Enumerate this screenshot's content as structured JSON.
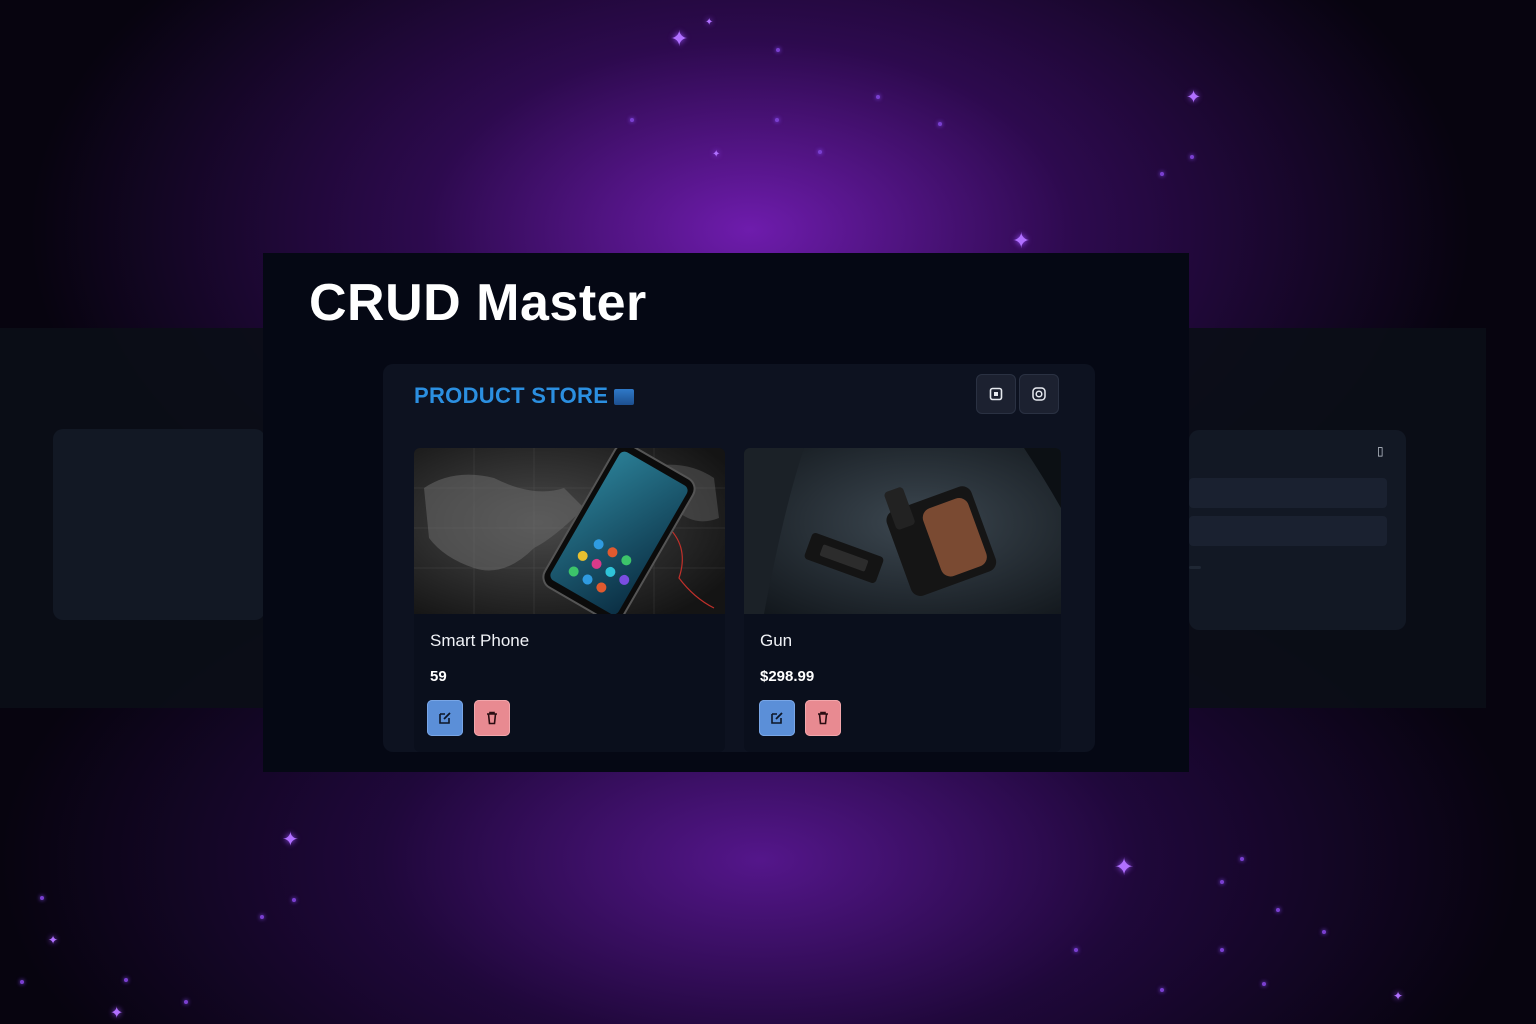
{
  "app": {
    "title": "CRUD Master"
  },
  "header": {
    "brand": "PRODUCT STORE",
    "brand_icon": "store-icon",
    "buttons": [
      {
        "icon": "add-square-icon"
      },
      {
        "icon": "theme-toggle-icon"
      }
    ]
  },
  "products": [
    {
      "name": "Smart Phone",
      "price": "59"
    },
    {
      "name": "Gun",
      "price": "$298.99"
    }
  ],
  "colors": {
    "brand": "#2b8fe0",
    "edit_button": "#5b8fd8",
    "delete_button": "#e88a91",
    "background_glow": "#8020c8"
  }
}
